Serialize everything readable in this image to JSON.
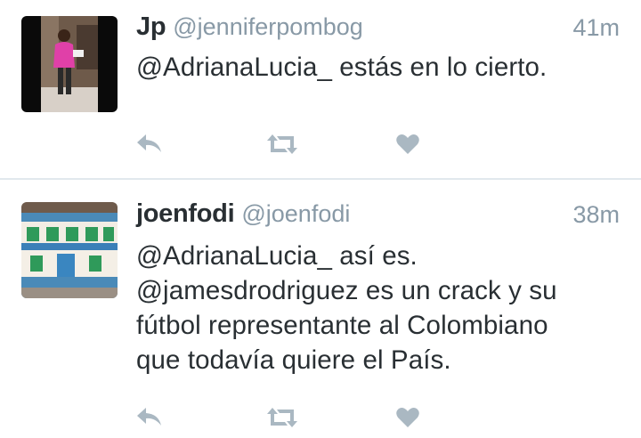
{
  "tweets": [
    {
      "name": "Jp",
      "handle": "@jenniferpombog",
      "time": "41m",
      "text": "@AdrianaLucia_ estás en lo cierto."
    },
    {
      "name": "joenfodi",
      "handle": "@joenfodi",
      "time": "38m",
      "text": "@AdrianaLucia_ así es.\n@jamesdrodriguez es un crack y su\nfútbol representante al Colombiano\nque todavía quiere el País."
    }
  ],
  "icons": {
    "reply": "reply-icon",
    "retweet": "retweet-icon",
    "favorite": "heart-icon"
  },
  "colors": {
    "text": "#292f33",
    "muted": "#8899a6",
    "action_icon": "#aab8c2",
    "divider": "#e1e8ed"
  }
}
